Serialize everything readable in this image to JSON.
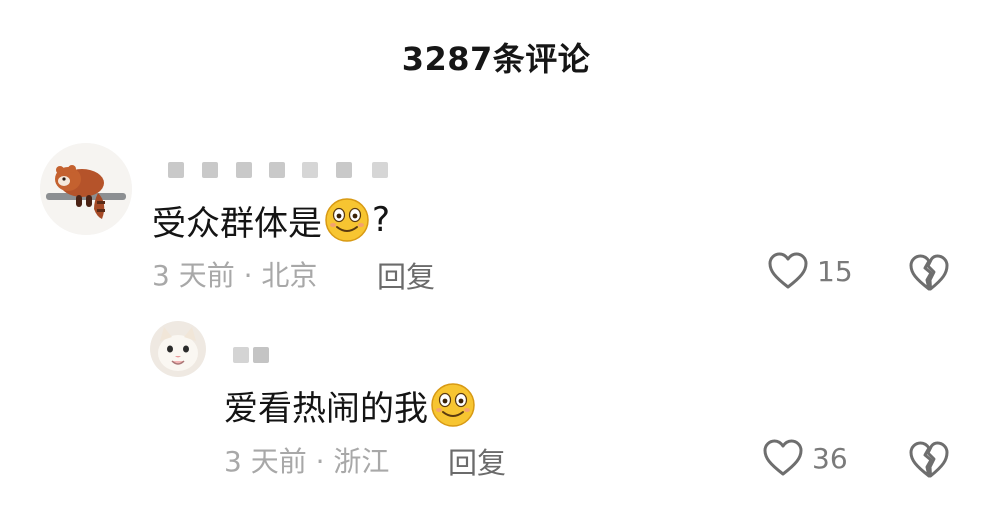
{
  "header": {
    "title": "3287条评论"
  },
  "comments": [
    {
      "avatar_icon": "red-panda-avatar",
      "text_before": "受众群体是",
      "emoji": "smile-emoji",
      "text_after": "?",
      "meta": "3 天前 · 北京",
      "reply_label": "回复",
      "likes": "15"
    }
  ],
  "replies": [
    {
      "avatar_icon": "cat-avatar",
      "text_before": "爱看热闹的我",
      "emoji": "smile-emoji",
      "text_after": "",
      "meta": "3 天前 · 浙江",
      "reply_label": "回复",
      "likes": "36"
    }
  ],
  "colors": {
    "text": "#141414",
    "meta": "#a8a8a8",
    "icon": "#7a7a7a",
    "emoji": "#f7c531"
  }
}
